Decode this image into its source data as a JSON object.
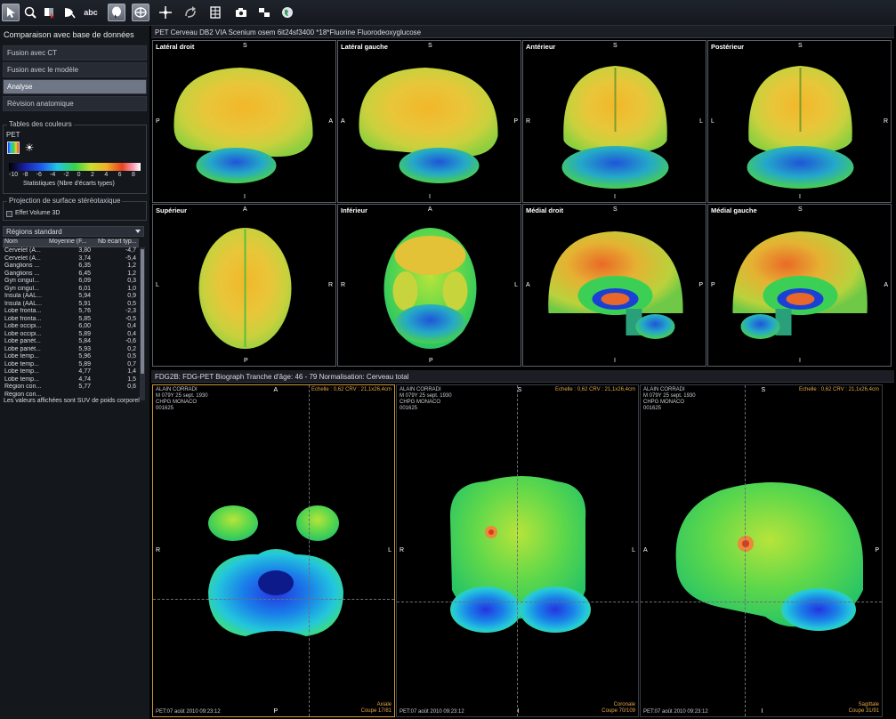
{
  "toolbar": {
    "tools": [
      {
        "name": "pointer-tool",
        "icon": "pointer-icon",
        "active": true
      },
      {
        "name": "zoom-tool",
        "icon": "magnifier-icon",
        "active": false
      },
      {
        "name": "window-level-tool",
        "icon": "contrast-cursor-icon",
        "active": false
      },
      {
        "name": "measure-tool",
        "icon": "measure-icon",
        "active": false
      },
      {
        "name": "annotation-tool",
        "icon": "text-annotation-icon",
        "label": "abc",
        "active": false
      },
      {
        "name": "brain-select-tool",
        "icon": "brain-select-icon",
        "active": true
      },
      {
        "name": "stereo-tool",
        "icon": "stereotactic-icon",
        "active": true
      },
      {
        "name": "crosshair-tool",
        "icon": "crosshair-icon",
        "active": false
      },
      {
        "name": "rotate-tool",
        "icon": "rotate-icon",
        "active": false
      },
      {
        "name": "grid-tool",
        "icon": "grid-icon",
        "active": false
      },
      {
        "name": "capture-tool",
        "icon": "camera-icon",
        "active": false
      },
      {
        "name": "layout-tool",
        "icon": "layout-icon",
        "active": false
      },
      {
        "name": "globe-tool",
        "icon": "globe-icon",
        "active": false
      }
    ]
  },
  "left": {
    "title": "Comparaison avec base de données",
    "nav": [
      "Fusion avec CT",
      "Fusion avec le modèle",
      "Analyse",
      "Révision anatomique"
    ],
    "active_nav": 2,
    "color_tables": {
      "legend": "Tables des couleurs",
      "label": "PET",
      "scale_ticks": [
        "-10",
        "-8",
        "-6",
        "-4",
        "-2",
        "0",
        "2",
        "4",
        "6",
        "8"
      ],
      "caption": "Statistiques (Nbre d'écarts types)"
    },
    "projection": {
      "legend": "Projection de surface stéréotaxique",
      "checkbox_label": "Effet Volume 3D",
      "checked": false
    },
    "regions_dropdown": "Régions standard",
    "table": {
      "headers": [
        "Nom",
        "Moyenne (F...",
        "Nb écart typ..."
      ],
      "rows": [
        [
          "Cervelet (A...",
          "3,80",
          "-4,7"
        ],
        [
          "Cervelet (A...",
          "3,74",
          "-5,4"
        ],
        [
          "Ganglions ...",
          "6,35",
          "1,2"
        ],
        [
          "Ganglions ...",
          "6,45",
          "1,2"
        ],
        [
          "Gyri cingul...",
          "6,09",
          "0,3"
        ],
        [
          "Gyri cingul...",
          "6,01",
          "1,0"
        ],
        [
          "Insula (AAL...",
          "5,94",
          "0,9"
        ],
        [
          "Insula (AAL...",
          "5,91",
          "0,5"
        ],
        [
          "Lobe fronta...",
          "5,76",
          "-2,3"
        ],
        [
          "Lobe fronta...",
          "5,85",
          "-0,5"
        ],
        [
          "Lobe occipi...",
          "6,00",
          "0,4"
        ],
        [
          "Lobe occipi...",
          "5,89",
          "0,4"
        ],
        [
          "Lobe pariét...",
          "5,84",
          "-0,6"
        ],
        [
          "Lobe pariét...",
          "5,93",
          "0,2"
        ],
        [
          "Lobe temp...",
          "5,96",
          "0,5"
        ],
        [
          "Lobe temp...",
          "5,89",
          "0,7"
        ],
        [
          "Lobe temp...",
          "4,77",
          "1,4"
        ],
        [
          "Lobe temp...",
          "4,74",
          "1,5"
        ],
        [
          "Région con...",
          "5,77",
          "0,6"
        ],
        [
          "Région con...",
          "",
          ""
        ]
      ]
    },
    "footnote": "Les valeurs affichées sont SUV de poids corporel"
  },
  "top_viewer": {
    "header": "PET Cerveau DB2 VIA Scenium osem 6it24sf3400     *18*Fluorine  Fluorodeoxyglucose",
    "panes": [
      {
        "name": "Latéral droit",
        "top": "S",
        "bottom": "I",
        "left": "P",
        "right": "A"
      },
      {
        "name": "Latéral gauche",
        "top": "S",
        "bottom": "I",
        "left": "A",
        "right": "P"
      },
      {
        "name": "Antérieur",
        "top": "S",
        "bottom": "I",
        "left": "R",
        "right": "L"
      },
      {
        "name": "Postérieur",
        "top": "S",
        "bottom": "I",
        "left": "L",
        "right": "R"
      },
      {
        "name": "Supérieur",
        "top": "A",
        "bottom": "P",
        "left": "L",
        "right": "R"
      },
      {
        "name": "Inférieur",
        "top": "A",
        "bottom": "P",
        "left": "R",
        "right": "L"
      },
      {
        "name": "Médial droit",
        "top": "S",
        "bottom": "I",
        "left": "A",
        "right": "P"
      },
      {
        "name": "Médial gauche",
        "top": "S",
        "bottom": "I",
        "left": "P",
        "right": "A"
      }
    ]
  },
  "bottom_viewer": {
    "header": "FDG2B: FDG-PET Biograph     Tranche d'âge: 46 - 79     Normalisation: Cerveau total",
    "panes": [
      {
        "info": [
          "ALAIN CORRADI",
          "M 079Y 25 sept. 1930",
          "CHPG MONACO",
          "001625"
        ],
        "scale": "Echelle : 0,62 CRV : 21,1x26,4cm",
        "top": "A",
        "bottom": "P",
        "left": "R",
        "right": "L",
        "date": "PET:07 août 2010 09:23:12",
        "view": "Axiale",
        "slice": "Coupe 17/81"
      },
      {
        "info": [
          "ALAIN CORRADI",
          "M 079Y 25 sept. 1930",
          "CHPG MONACO",
          "001625"
        ],
        "scale": "Echelle : 0,62 CRV : 21,1x26,4cm",
        "top": "S",
        "bottom": "I",
        "left": "R",
        "right": "L",
        "date": "PET:07 août 2010 09:23:12",
        "view": "Coronale",
        "slice": "Coupe 70/109"
      },
      {
        "info": [
          "ALAIN CORRADI",
          "M 079Y 25 sept. 1930",
          "CHPG MONACO",
          "001625"
        ],
        "scale": "Echelle : 0,62 CRV : 21,1x26,4cm",
        "top": "S",
        "bottom": "I",
        "left": "A",
        "right": "P",
        "date": "PET:07 août 2010 09:23:12",
        "view": "Sagittale",
        "slice": "Coupe 31/91"
      }
    ]
  },
  "colors": {
    "active_nav": "#6f7787",
    "selected_pane": "#c9963a",
    "orange_text": "#e3a44a"
  }
}
